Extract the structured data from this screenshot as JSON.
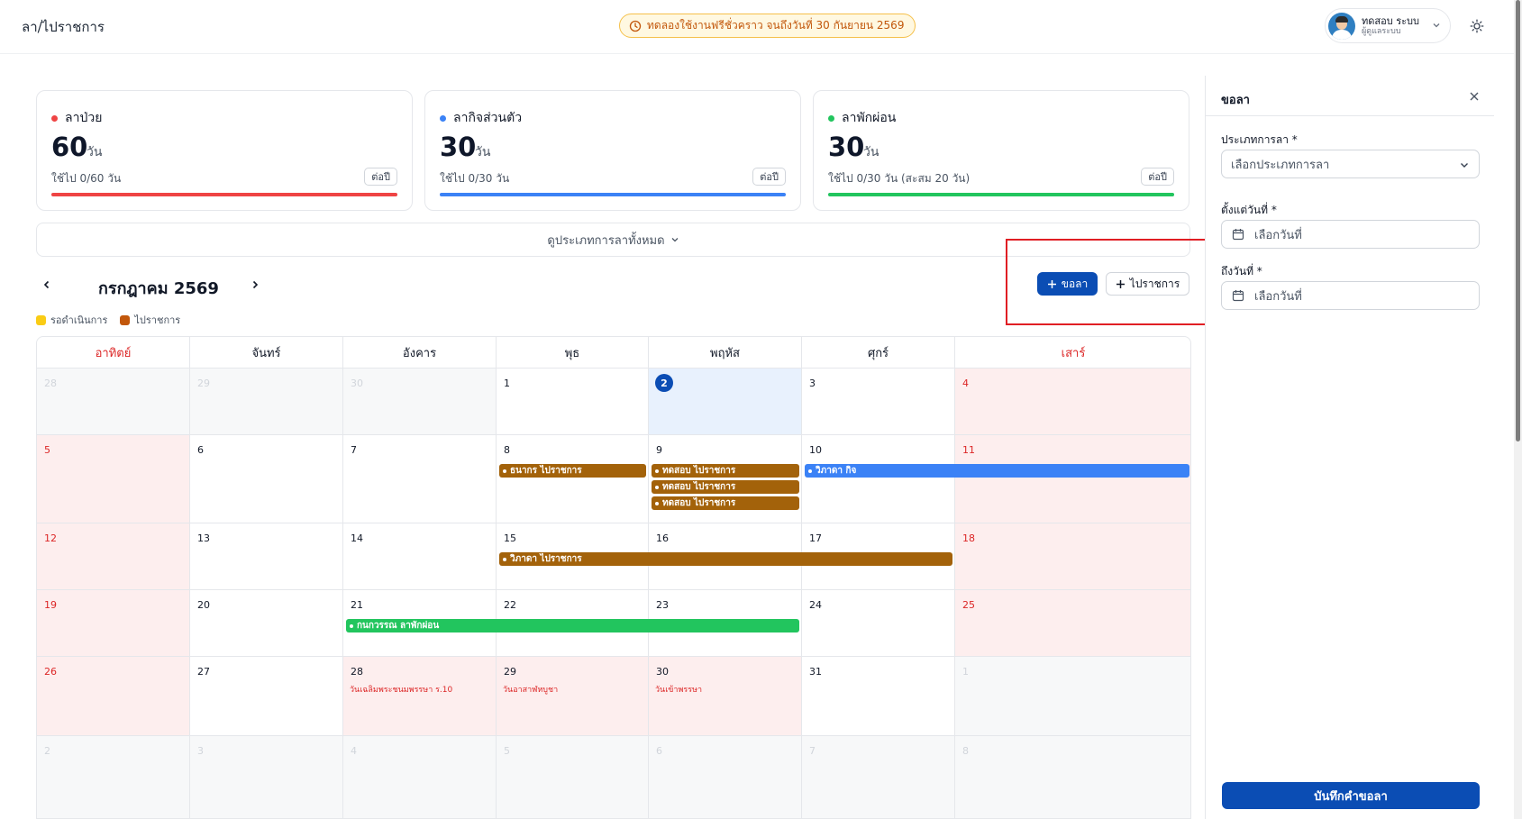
{
  "header": {
    "title": "ลา/ไปราชการ",
    "trial_text": "ทดลองใช้งานฟรีชั่วคราว จนถึงวันที่ 30 กันยายน 2569",
    "user_name": "ทดสอบ ระบบ",
    "user_role": "ผู้ดูแลระบบ"
  },
  "cards": [
    {
      "title": "ลาป่วย",
      "value": "60",
      "unit": "วัน",
      "used": "ใช้ไป 0/60 วัน",
      "badge": "ต่อปี",
      "color": "#ef4444"
    },
    {
      "title": "ลากิจส่วนตัว",
      "value": "30",
      "unit": "วัน",
      "used": "ใช้ไป 0/30 วัน",
      "badge": "ต่อปี",
      "color": "#3b82f6"
    },
    {
      "title": "ลาพักผ่อน",
      "value": "30",
      "unit": "วัน",
      "used": "ใช้ไป 0/30 วัน (สะสม 20 วัน)",
      "badge": "ต่อปี",
      "color": "#22c55e"
    }
  ],
  "expand_label": "ดูประเภทการลาทั้งหมด",
  "calendar": {
    "month_label": "กรกฎาคม 2569",
    "add_leave_label": "ขอลา",
    "add_official_label": "ไปราชการ",
    "legend": [
      {
        "label": "รอดำเนินการ",
        "color": "#facc15"
      },
      {
        "label": "ไปราชการ",
        "color": "#c2570b"
      }
    ],
    "weekdays": [
      "อาทิตย์",
      "จันทร์",
      "อังคาร",
      "พุธ",
      "พฤหัส",
      "ศุกร์",
      "เสาร์"
    ],
    "weeks": [
      [
        "28",
        "29",
        "30",
        "1",
        "2",
        "3",
        "4"
      ],
      [
        "5",
        "6",
        "7",
        "8",
        "9",
        "10",
        "11"
      ],
      [
        "12",
        "13",
        "14",
        "15",
        "16",
        "17",
        "18"
      ],
      [
        "19",
        "20",
        "21",
        "22",
        "23",
        "24",
        "25"
      ],
      [
        "26",
        "27",
        "28",
        "29",
        "30",
        "31",
        "1"
      ],
      [
        "2",
        "3",
        "4",
        "5",
        "6",
        "7",
        "8"
      ]
    ],
    "holidays": [
      {
        "week": 4,
        "day": 2,
        "name": "วันเฉลิมพระชนมพรรษา ร.10"
      },
      {
        "week": 4,
        "day": 3,
        "name": "วันอาสาฬหบูชา"
      },
      {
        "week": 4,
        "day": 4,
        "name": "วันเข้าพรรษา"
      }
    ],
    "events": [
      {
        "week": 1,
        "start": 3,
        "end": 3,
        "row": 0,
        "label": "ธนากร ไปราชการ",
        "color": "#a3620a"
      },
      {
        "week": 1,
        "start": 4,
        "end": 4,
        "row": 0,
        "label": "ทดสอบ ไปราชการ",
        "color": "#a3620a"
      },
      {
        "week": 1,
        "start": 4,
        "end": 4,
        "row": 1,
        "label": "ทดสอบ ไปราชการ",
        "color": "#a3620a"
      },
      {
        "week": 1,
        "start": 4,
        "end": 4,
        "row": 2,
        "label": "ทดสอบ ไปราชการ",
        "color": "#a3620a"
      },
      {
        "week": 1,
        "start": 5,
        "end": 6,
        "row": 0,
        "label": "วิภาดา กิจ",
        "color": "#3b82f6"
      },
      {
        "week": 2,
        "start": 3,
        "end": 5,
        "row": 0,
        "label": "วิภาดา ไปราชการ",
        "color": "#a3620a"
      },
      {
        "week": 3,
        "start": 2,
        "end": 4,
        "row": 0,
        "label": "กนกวรรณ ลาพักผ่อน",
        "color": "#22c55e"
      }
    ]
  },
  "panel": {
    "title": "ขอลา",
    "type_label": "ประเภทการลา *",
    "type_placeholder": "เลือกประเภทการลา",
    "from_label": "ตั้งแต่วันที่ *",
    "from_placeholder": "เลือกวันที่",
    "to_label": "ถึงวันที่ *",
    "to_placeholder": "เลือกวันที่",
    "submit_label": "บันทึกคำขอลา"
  }
}
